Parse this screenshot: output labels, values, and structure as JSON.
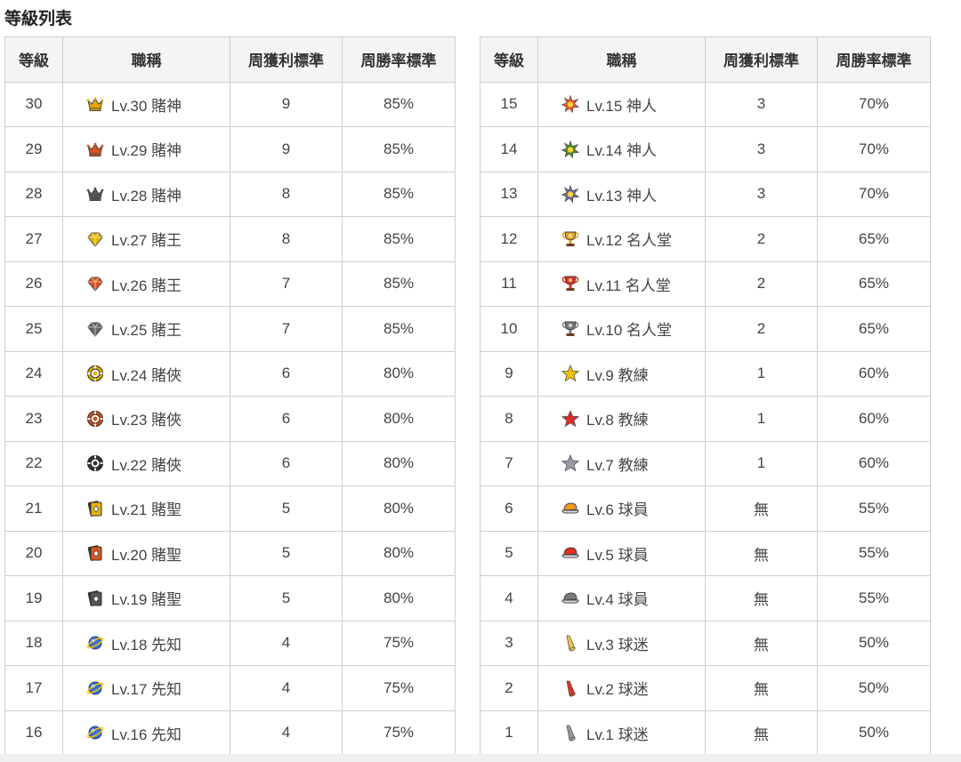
{
  "heading": "等級列表",
  "columns": [
    "等級",
    "職稱",
    "周獲利標準",
    "周勝率標準"
  ],
  "left_rows": [
    {
      "level": "30",
      "title": "Lv.30 賭神",
      "profit": "9",
      "winrate": "85%",
      "icon": "crown",
      "color": "#e5a800"
    },
    {
      "level": "29",
      "title": "Lv.29 賭神",
      "profit": "9",
      "winrate": "85%",
      "icon": "crown",
      "color": "#d9541e"
    },
    {
      "level": "28",
      "title": "Lv.28 賭神",
      "profit": "8",
      "winrate": "85%",
      "icon": "crown",
      "color": "#555555"
    },
    {
      "level": "27",
      "title": "Lv.27 賭王",
      "profit": "8",
      "winrate": "85%",
      "icon": "diamond",
      "color": "#e5b400"
    },
    {
      "level": "26",
      "title": "Lv.26 賭王",
      "profit": "7",
      "winrate": "85%",
      "icon": "diamond",
      "color": "#d9541e"
    },
    {
      "level": "25",
      "title": "Lv.25 賭王",
      "profit": "7",
      "winrate": "85%",
      "icon": "diamond",
      "color": "#666666"
    },
    {
      "level": "24",
      "title": "Lv.24 賭俠",
      "profit": "6",
      "winrate": "80%",
      "icon": "chip",
      "color": "#e5b400"
    },
    {
      "level": "23",
      "title": "Lv.23 賭俠",
      "profit": "6",
      "winrate": "80%",
      "icon": "chip",
      "color": "#d9541e"
    },
    {
      "level": "22",
      "title": "Lv.22 賭俠",
      "profit": "6",
      "winrate": "80%",
      "icon": "chip",
      "color": "#333333"
    },
    {
      "level": "21",
      "title": "Lv.21 賭聖",
      "profit": "5",
      "winrate": "80%",
      "icon": "card",
      "color": "#e5b400"
    },
    {
      "level": "20",
      "title": "Lv.20 賭聖",
      "profit": "5",
      "winrate": "80%",
      "icon": "card",
      "color": "#d9541e"
    },
    {
      "level": "19",
      "title": "Lv.19 賭聖",
      "profit": "5",
      "winrate": "80%",
      "icon": "card",
      "color": "#555555"
    },
    {
      "level": "18",
      "title": "Lv.18 先知",
      "profit": "4",
      "winrate": "75%",
      "icon": "planet",
      "color": "#3a6fd8"
    },
    {
      "level": "17",
      "title": "Lv.17 先知",
      "profit": "4",
      "winrate": "75%",
      "icon": "planet",
      "color": "#3a6fd8"
    },
    {
      "level": "16",
      "title": "Lv.16 先知",
      "profit": "4",
      "winrate": "75%",
      "icon": "planet",
      "color": "#3a6fd8"
    }
  ],
  "right_rows": [
    {
      "level": "15",
      "title": "Lv.15 神人",
      "profit": "3",
      "winrate": "70%",
      "icon": "burst",
      "color": "#e8552a"
    },
    {
      "level": "14",
      "title": "Lv.14 神人",
      "profit": "3",
      "winrate": "70%",
      "icon": "burst",
      "color": "#4a8a2a"
    },
    {
      "level": "13",
      "title": "Lv.13 神人",
      "profit": "3",
      "winrate": "70%",
      "icon": "burst",
      "color": "#6a6a9a"
    },
    {
      "level": "12",
      "title": "Lv.12 名人堂",
      "profit": "2",
      "winrate": "65%",
      "icon": "trophy",
      "color": "#e5a020"
    },
    {
      "level": "11",
      "title": "Lv.11 名人堂",
      "profit": "2",
      "winrate": "65%",
      "icon": "trophy",
      "color": "#d9341e"
    },
    {
      "level": "10",
      "title": "Lv.10 名人堂",
      "profit": "2",
      "winrate": "65%",
      "icon": "trophy",
      "color": "#777777"
    },
    {
      "level": "9",
      "title": "Lv.9 教練",
      "profit": "1",
      "winrate": "60%",
      "icon": "star",
      "color": "#f2c200"
    },
    {
      "level": "8",
      "title": "Lv.8 教練",
      "profit": "1",
      "winrate": "60%",
      "icon": "star",
      "color": "#e02a2a"
    },
    {
      "level": "7",
      "title": "Lv.7 教練",
      "profit": "1",
      "winrate": "60%",
      "icon": "star",
      "color": "#9a9aa8"
    },
    {
      "level": "6",
      "title": "Lv.6 球員",
      "profit": "無",
      "winrate": "55%",
      "icon": "cap",
      "color": "#f39a1e"
    },
    {
      "level": "5",
      "title": "Lv.5 球員",
      "profit": "無",
      "winrate": "55%",
      "icon": "cap",
      "color": "#e0301e"
    },
    {
      "level": "4",
      "title": "Lv.4 球員",
      "profit": "無",
      "winrate": "55%",
      "icon": "cap",
      "color": "#7a7a7a"
    },
    {
      "level": "3",
      "title": "Lv.3 球迷",
      "profit": "無",
      "winrate": "50%",
      "icon": "horn",
      "color": "#f2c24a"
    },
    {
      "level": "2",
      "title": "Lv.2 球迷",
      "profit": "無",
      "winrate": "50%",
      "icon": "horn",
      "color": "#e0301e"
    },
    {
      "level": "1",
      "title": "Lv.1 球迷",
      "profit": "無",
      "winrate": "50%",
      "icon": "horn",
      "color": "#999999"
    }
  ]
}
